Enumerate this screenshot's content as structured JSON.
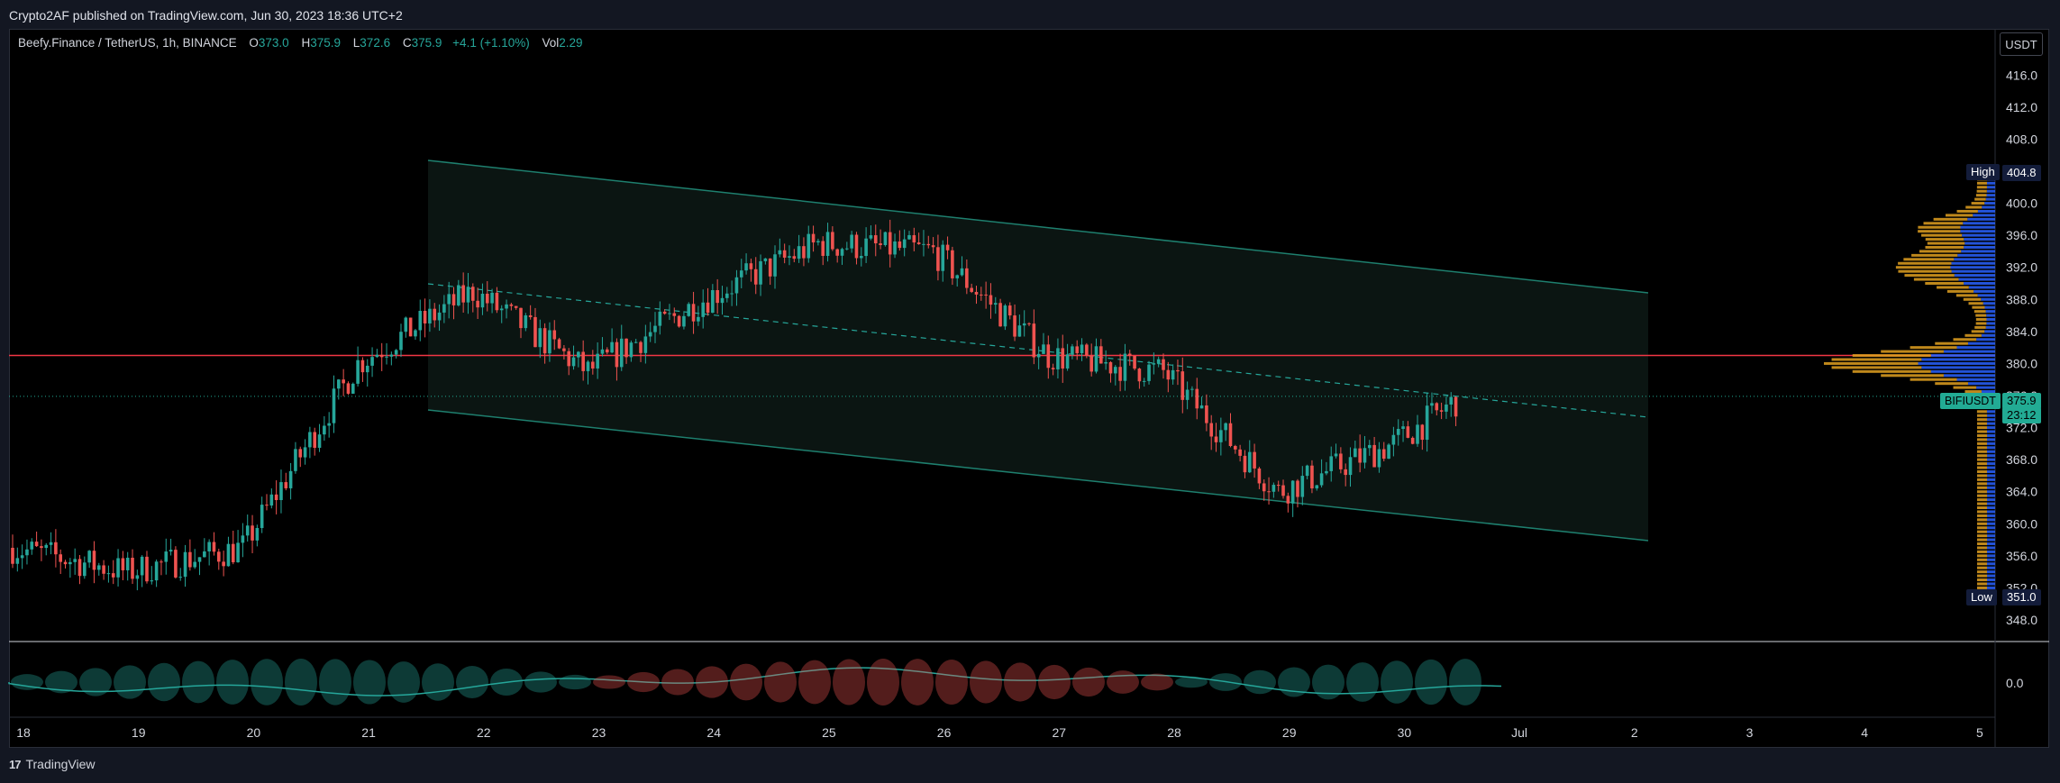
{
  "publisher_line": "Crypto2AF published on TradingView.com, Jun 30, 2023 18:36 UTC+2",
  "legend": {
    "symbol": "Beefy.Finance / TetherUS, 1h, BINANCE",
    "o_label": "O",
    "o_value": "373.0",
    "h_label": "H",
    "h_value": "375.9",
    "l_label": "L",
    "l_value": "372.6",
    "c_label": "C",
    "c_value": "375.9",
    "change": "+4.1 (+1.10%)",
    "vol_label": "Vol",
    "vol_value": "2.29"
  },
  "currency_button": "USDT",
  "price_axis": [
    "416.0",
    "412.0",
    "408.0",
    "404.0",
    "400.0",
    "396.0",
    "392.0",
    "388.0",
    "384.0",
    "380.0",
    "376.0",
    "372.0",
    "368.0",
    "364.0",
    "360.0",
    "356.0",
    "352.0",
    "348.0"
  ],
  "oscillator_axis": "0.0",
  "date_axis": [
    "18",
    "19",
    "20",
    "21",
    "22",
    "23",
    "24",
    "25",
    "26",
    "27",
    "28",
    "29",
    "30",
    "Jul",
    "2",
    "3",
    "4",
    "5"
  ],
  "tags": {
    "high_label": "High",
    "high_value": "404.8",
    "low_label": "Low",
    "low_value": "351.0",
    "symbol": "BIFIUSDT",
    "price": "375.9",
    "countdown": "23:12"
  },
  "colors": {
    "up": "#26a69a",
    "down": "#ef5350",
    "channel": "#1e7f6e",
    "resistance": "#f23645",
    "profile_up": "#2962ff",
    "profile_down": "#e0a020"
  },
  "footer": {
    "brand": "TradingView",
    "logo": "17"
  },
  "chart_data": {
    "type": "candlestick",
    "symbol": "BIFIUSDT",
    "timeframe": "1h",
    "x_axis": [
      "18",
      "19",
      "20",
      "21",
      "22",
      "23",
      "24",
      "25",
      "26",
      "27",
      "28",
      "29",
      "30",
      "Jul",
      "2",
      "3",
      "4",
      "5"
    ],
    "y_range": [
      348,
      418
    ],
    "high": 404.8,
    "low": 351.0,
    "last": 375.9,
    "resistance_level": 381.0,
    "approx_closes_by_day": [
      {
        "day": "18",
        "close": 357
      },
      {
        "day": "19",
        "close": 354
      },
      {
        "day": "20",
        "close": 357
      },
      {
        "day": "21",
        "close": 380
      },
      {
        "day": "22",
        "close": 389
      },
      {
        "day": "23",
        "close": 379
      },
      {
        "day": "24",
        "close": 388
      },
      {
        "day": "25",
        "close": 395
      },
      {
        "day": "26",
        "close": 394
      },
      {
        "day": "27",
        "close": 381
      },
      {
        "day": "28",
        "close": 379
      },
      {
        "day": "29",
        "close": 364
      },
      {
        "day": "30",
        "close": 370
      },
      {
        "day": "30.6",
        "close": 375.9
      }
    ]
  }
}
